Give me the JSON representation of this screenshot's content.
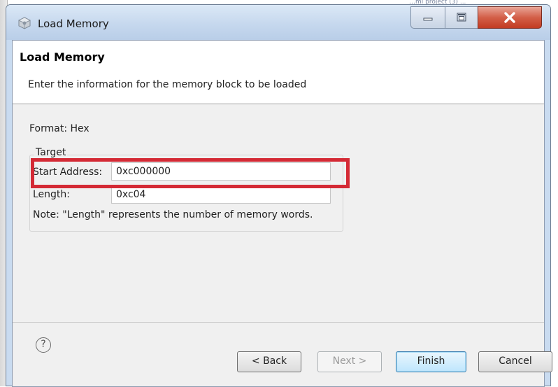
{
  "background": {
    "app_text": "…ml project (3) ..."
  },
  "window": {
    "title": "Load Memory"
  },
  "header": {
    "title": "Load Memory",
    "description": "Enter the information for the memory block to be loaded"
  },
  "form": {
    "format_label": "Format: Hex",
    "group_label": "Target",
    "start_address_label": "Start Address:",
    "start_address_value": "0xc000000",
    "length_label": "Length:",
    "length_value": "0xc04",
    "note": "Note: \"Length\" represents the number of memory words."
  },
  "footer": {
    "help_symbol": "?",
    "back_label": "< Back",
    "next_label": "Next >",
    "finish_label": "Finish",
    "cancel_label": "Cancel"
  },
  "colors": {
    "highlight": "#d42a35",
    "close_button": "#c23b22",
    "titlebar": "#c6d8ee"
  },
  "icons": {
    "window_icon": "gear-cube-icon",
    "minimize": "minimize-icon",
    "maximize": "maximize-icon",
    "close": "close-icon",
    "help": "help-icon"
  }
}
